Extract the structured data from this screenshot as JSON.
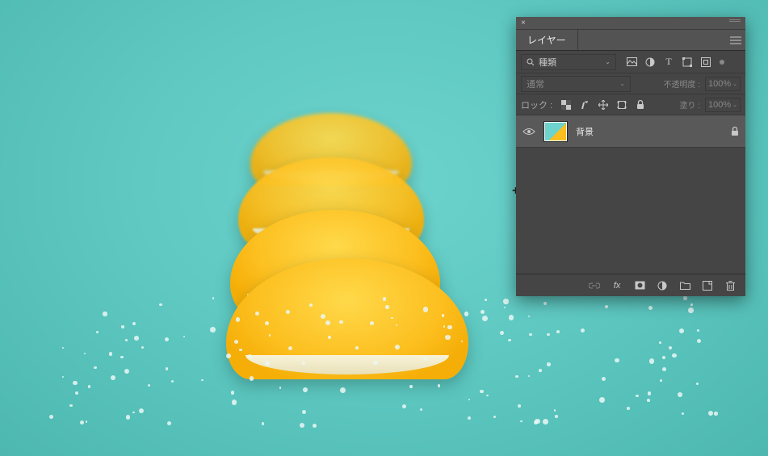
{
  "panel": {
    "title": "レイヤー",
    "filter": {
      "search_icon": "search-icon",
      "selected": "種類",
      "type_icons": [
        "image-filter-icon",
        "adjustment-filter-icon",
        "type-filter-icon",
        "shape-filter-icon",
        "smart-filter-icon"
      ]
    },
    "blend": {
      "mode": "通常",
      "opacity_label": "不透明度 :",
      "opacity_value": "100%"
    },
    "lock": {
      "label": "ロック :",
      "icons": [
        "lock-transparent-icon",
        "lock-image-icon",
        "lock-position-icon",
        "lock-artboard-icon",
        "lock-all-icon"
      ],
      "fill_label": "塗り :",
      "fill_value": "100%"
    },
    "layers": [
      {
        "name": "背景",
        "visible": true,
        "locked": true
      }
    ],
    "footer_icons": [
      "link-icon",
      "fx-icon",
      "mask-icon",
      "adjustment-icon",
      "group-icon",
      "new-layer-icon",
      "delete-icon"
    ]
  }
}
